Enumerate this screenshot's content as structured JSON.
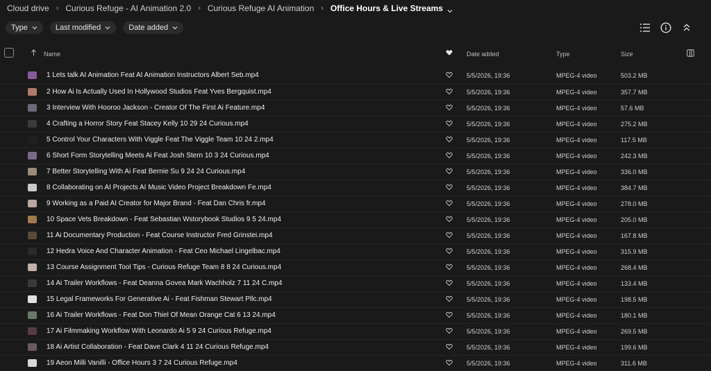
{
  "breadcrumb": {
    "items": [
      "Cloud drive",
      "Curious Refuge - AI Animation 2.0",
      "Curious Refuge AI Animation"
    ],
    "current": "Office Hours & Live Streams"
  },
  "filters": {
    "type_label": "Type",
    "last_modified_label": "Last modified",
    "date_added_label": "Date added"
  },
  "columns": {
    "name": "Name",
    "date_added": "Date added",
    "type": "Type",
    "size": "Size"
  },
  "files": [
    {
      "name": "1 Lets talk AI Animation Feat AI Animation Instructors Albert Seb.mp4",
      "date": "5/5/2026, 19:36",
      "type": "MPEG-4 video",
      "size": "503.2 MB",
      "thumb": "#8a5a9a"
    },
    {
      "name": "2 How Ai Is Actually Used In Hollywood Studios Feat Yves Bergquist.mp4",
      "date": "5/5/2026, 19:36",
      "type": "MPEG-4 video",
      "size": "357.7 MB",
      "thumb": "#b07a6a"
    },
    {
      "name": "3 Interview With Hooroo Jackson - Creator Of The First Ai Feature.mp4",
      "date": "5/5/2026, 19:36",
      "type": "MPEG-4 video",
      "size": "57.6 MB",
      "thumb": "#6a6a7a"
    },
    {
      "name": "4 Crafting a Horror Story Feat Stacey Kelly 10 29 24 Curious.mp4",
      "date": "5/5/2026, 19:36",
      "type": "MPEG-4 video",
      "size": "275.2 MB",
      "thumb": "#3a3a3a"
    },
    {
      "name": "5 Control Your Characters With Viggle Feat The Viggle Team 10 24 2.mp4",
      "date": "5/5/2026, 19:36",
      "type": "MPEG-4 video",
      "size": "117.5 MB",
      "thumb": "#202020"
    },
    {
      "name": "6 Short Form Storytelling Meets Ai Feat Josh Stern 10 3 24 Curious.mp4",
      "date": "5/5/2026, 19:36",
      "type": "MPEG-4 video",
      "size": "242.3 MB",
      "thumb": "#7a6a8a"
    },
    {
      "name": "7 Better Storytelling With Ai Feat Bernie Su 9 24 24 Curious.mp4",
      "date": "5/5/2026, 19:36",
      "type": "MPEG-4 video",
      "size": "336.0 MB",
      "thumb": "#9a8a7a"
    },
    {
      "name": "8 Collaborating on AI Projects AI Music Video Project Breakdown Fe.mp4",
      "date": "5/5/2026, 19:36",
      "type": "MPEG-4 video",
      "size": "384.7 MB",
      "thumb": "#c8c8c8"
    },
    {
      "name": "9 Working as a Paid AI Creator for Major Brand - Feat Dan Chris fr.mp4",
      "date": "5/5/2026, 19:36",
      "type": "MPEG-4 video",
      "size": "278.0 MB",
      "thumb": "#b8a8a0"
    },
    {
      "name": "10 Space Vets Breakdown - Feat Sebastian Wstorybook Studios 9 5 24.mp4",
      "date": "5/5/2026, 19:36",
      "type": "MPEG-4 video",
      "size": "205.0 MB",
      "thumb": "#a07a4a"
    },
    {
      "name": "11 Ai Documentary Production - Feat Course Instructor Fred Grinstei.mp4",
      "date": "5/5/2026, 19:36",
      "type": "MPEG-4 video",
      "size": "167.8 MB",
      "thumb": "#5a4a3a"
    },
    {
      "name": "12 Hedra Voice And Character Animation - Feat Ceo Michael Lingelbac.mp4",
      "date": "5/5/2026, 19:36",
      "type": "MPEG-4 video",
      "size": "315.9 MB",
      "thumb": "#2a2a2a"
    },
    {
      "name": "13 Course Assignment Tool Tips - Curious Refuge Team 8 8 24 Curious.mp4",
      "date": "5/5/2026, 19:36",
      "type": "MPEG-4 video",
      "size": "268.4 MB",
      "thumb": "#c0b0a8"
    },
    {
      "name": "14 Ai Trailer Workflows - Feat Deanna Govea Mark Wachholz 7 11 24 C.mp4",
      "date": "5/5/2026, 19:36",
      "type": "MPEG-4 video",
      "size": "133.4 MB",
      "thumb": "#3a3a3a"
    },
    {
      "name": "15 Legal Frameworks For Generative Ai - Feat Fishman Stewart Pllc.mp4",
      "date": "5/5/2026, 19:36",
      "type": "MPEG-4 video",
      "size": "198.5 MB",
      "thumb": "#e0e0e0"
    },
    {
      "name": "16 Ai Trailer Workflows - Feat Don Thiel Of Mean Orange Cat 6 13 24.mp4",
      "date": "5/5/2026, 19:36",
      "type": "MPEG-4 video",
      "size": "180.1 MB",
      "thumb": "#6a7a6a"
    },
    {
      "name": "17 Ai Filmmaking Workflow With Leonardo Ai 5 9 24 Curious Refuge.mp4",
      "date": "5/5/2026, 19:36",
      "type": "MPEG-4 video",
      "size": "269.5 MB",
      "thumb": "#5a3a4a"
    },
    {
      "name": "18 Ai Artist Collaboration - Feat Dave Clark 4 11 24 Curious Refuge.mp4",
      "date": "5/5/2026, 19:36",
      "type": "MPEG-4 video",
      "size": "199.6 MB",
      "thumb": "#6a5a5a"
    },
    {
      "name": "19 Aeon Milli Vanilli - Office Hours 3 7 24 Curious Refuge.mp4",
      "date": "5/5/2026, 19:36",
      "type": "MPEG-4 video",
      "size": "311.6 MB",
      "thumb": "#d8d8d8"
    }
  ],
  "icons": {
    "list_view": "list-view-icon",
    "info": "info-icon",
    "collapse": "collapse-icon",
    "heart": "heart-icon",
    "sort": "sort-arrow-up-icon",
    "columns": "columns-icon"
  }
}
